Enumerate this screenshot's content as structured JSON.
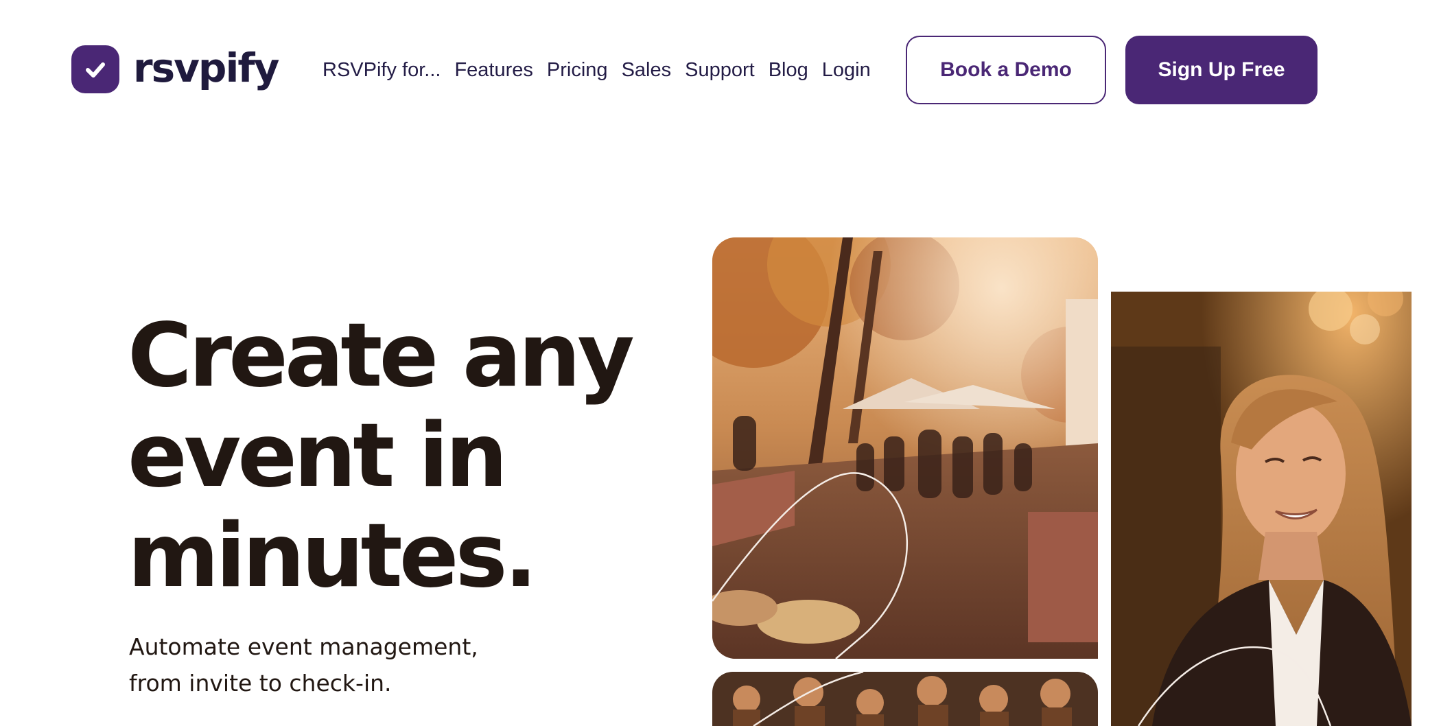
{
  "brand": {
    "name": "rsvpify",
    "logo_icon": "check-icon",
    "color": "#4a2775"
  },
  "nav": {
    "items": [
      {
        "label": "RSVPify for..."
      },
      {
        "label": "Features"
      },
      {
        "label": "Pricing"
      },
      {
        "label": "Sales"
      },
      {
        "label": "Support"
      },
      {
        "label": "Blog"
      },
      {
        "label": "Login"
      }
    ]
  },
  "header": {
    "demo_label": "Book a Demo",
    "signup_label": "Sign Up Free"
  },
  "hero": {
    "title_lines": [
      "Create any",
      "event in",
      "minutes."
    ],
    "subtitle_lines": [
      "Automate event management,",
      "from invite to check-in."
    ]
  },
  "colors": {
    "accent": "#4a2775",
    "nav_text": "#231c46",
    "headline": "#211712"
  }
}
